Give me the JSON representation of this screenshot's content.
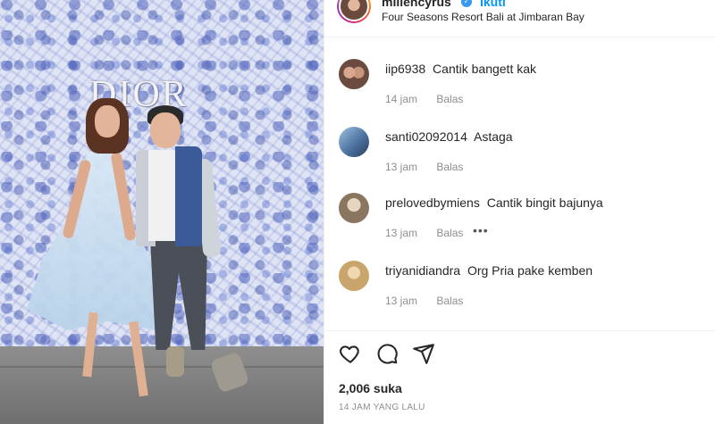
{
  "photo": {
    "brand_text": "DIOR"
  },
  "header": {
    "username": "millencyrus",
    "follow_label": "Ikuti",
    "location": "Four Seasons Resort Bali at Jimbaran Bay"
  },
  "comments": [
    {
      "username": "iip6938",
      "text": "Cantik bangett kak",
      "time": "14 jam",
      "reply_label": "Balas",
      "avatar_color": "#6b4a3f"
    },
    {
      "username": "santi02092014",
      "text": "Astaga",
      "time": "13 jam",
      "reply_label": "Balas",
      "avatar_color": "#5d7ea8"
    },
    {
      "username": "prelovedbymiens",
      "text": "Cantik bingit bajunya",
      "time": "13 jam",
      "reply_label": "Balas",
      "more_icon": "more-horizontal-icon",
      "avatar_color": "#8a7560"
    },
    {
      "username": "triyanidiandra",
      "text": "Org Pria pake kemben",
      "time": "13 jam",
      "reply_label": "Balas",
      "avatar_color": "#c9a56b"
    }
  ],
  "actions": {
    "icons": [
      "heart-icon",
      "comment-icon",
      "share-icon"
    ],
    "likes": "2,006 suka",
    "timestamp": "14 JAM YANG LALU"
  },
  "colors": {
    "accent": "#0095f6",
    "verified": "#3897f0",
    "meta_gray": "#8e8e8e"
  }
}
